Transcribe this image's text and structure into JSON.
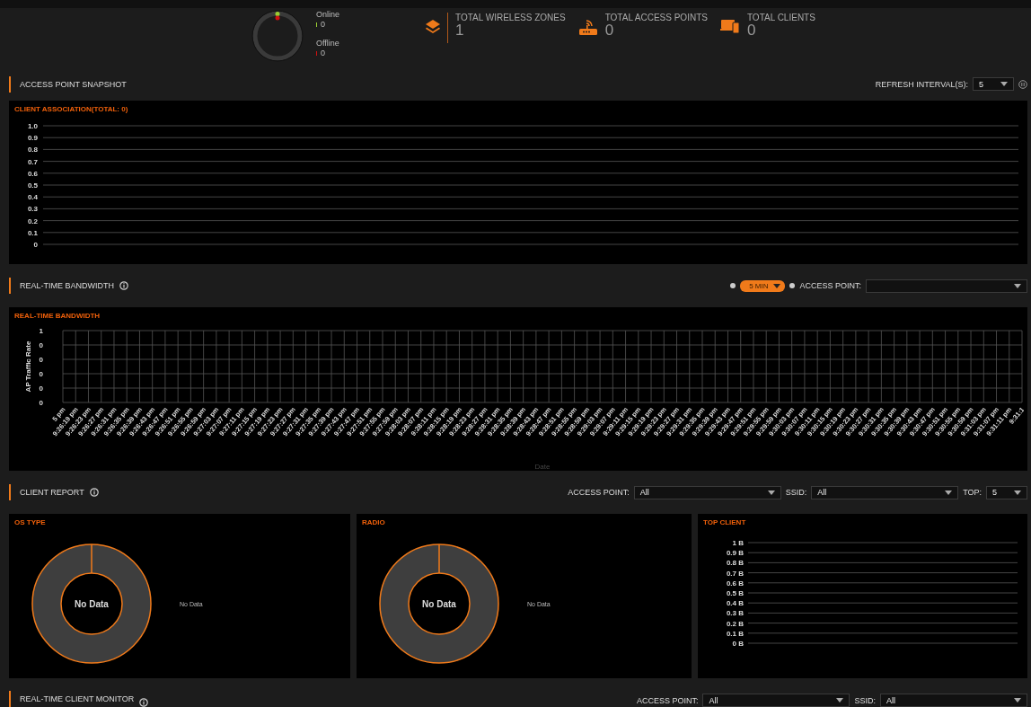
{
  "summary": {
    "online_label": "Online",
    "online_count": "0",
    "offline_label": "Offline",
    "offline_count": "0",
    "stats": [
      {
        "kind": "zones",
        "label": "TOTAL WIRELESS ZONES",
        "value": "1"
      },
      {
        "kind": "access_points",
        "label": "TOTAL ACCESS POINTS",
        "value": "0"
      },
      {
        "kind": "clients",
        "label": "TOTAL CLIENTS",
        "value": "0"
      }
    ]
  },
  "snapshot": {
    "title": "ACCESS POINT SNAPSHOT",
    "refresh_label": "REFRESH INTERVAL(S):",
    "refresh_value": "5",
    "panel": {
      "title": "CLIENT ASSOCIATION(TOTAL: 0)",
      "y_axis_labels": [
        "1.0",
        "0.9",
        "0.8",
        "0.7",
        "0.6",
        "0.5",
        "0.4",
        "0.3",
        "0.2",
        "0.1",
        "0"
      ]
    }
  },
  "bandwidth": {
    "title": "REAL-TIME BANDWIDTH",
    "range_value": "5 MIN",
    "access_point_label": "ACCESS POINT:",
    "panel": {
      "title": "REAL-TIME BANDWIDTH",
      "x_axis_title": "Date",
      "y_axis_title": "AP Traffic Rate",
      "y_axis_labels": [
        "1",
        "0",
        "0",
        "0",
        "0",
        "0"
      ],
      "x_axis_labels": [
        "5 pm",
        "9:26:19 pm",
        "9:26:23 pm",
        "9:26:27 pm",
        "9:26:31 pm",
        "9:26:35 pm",
        "9:26:39 pm",
        "9:26:43 pm",
        "9:26:47 pm",
        "9:26:51 pm",
        "9:26:55 pm",
        "9:26:59 pm",
        "9:27:03 pm",
        "9:27:07 pm",
        "9:27:11 pm",
        "9:27:15 pm",
        "9:27:19 pm",
        "9:27:23 pm",
        "9:27:27 pm",
        "9:27:31 pm",
        "9:27:35 pm",
        "9:27:39 pm",
        "9:27:43 pm",
        "9:27:47 pm",
        "9:27:51 pm",
        "9:27:55 pm",
        "9:27:59 pm",
        "9:28:03 pm",
        "9:28:07 pm",
        "9:28:11 pm",
        "9:28:15 pm",
        "9:28:19 pm",
        "9:28:23 pm",
        "9:28:27 pm",
        "9:28:31 pm",
        "9:28:35 pm",
        "9:28:39 pm",
        "9:28:43 pm",
        "9:28:47 pm",
        "9:28:51 pm",
        "9:28:55 pm",
        "9:28:59 pm",
        "9:29:03 pm",
        "9:29:07 pm",
        "9:29:11 pm",
        "9:29:15 pm",
        "9:29:19 pm",
        "9:29:23 pm",
        "9:29:27 pm",
        "9:29:31 pm",
        "9:29:35 pm",
        "9:29:39 pm",
        "9:29:43 pm",
        "9:29:47 pm",
        "9:29:51 pm",
        "9:29:55 pm",
        "9:29:59 pm",
        "9:30:03 pm",
        "9:30:07 pm",
        "9:30:11 pm",
        "9:30:15 pm",
        "9:30:19 pm",
        "9:30:23 pm",
        "9:30:27 pm",
        "9:30:31 pm",
        "9:30:35 pm",
        "9:30:39 pm",
        "9:30:43 pm",
        "9:30:47 pm",
        "9:30:51 pm",
        "9:30:55 pm",
        "9:30:59 pm",
        "9:31:03 pm",
        "9:31:07 pm",
        "9:31:11 pm",
        "9:31:1"
      ]
    }
  },
  "client_report": {
    "title": "CLIENT REPORT",
    "filters": [
      {
        "label": "ACCESS POINT:",
        "value": "All"
      },
      {
        "label": "SSID:",
        "value": "All"
      },
      {
        "label": "TOP:",
        "value": "5"
      }
    ],
    "panels": [
      {
        "kind": "donut",
        "title": "OS TYPE",
        "center_text": "No Data",
        "legend": "No Data"
      },
      {
        "kind": "donut",
        "title": "RADIO",
        "center_text": "No Data",
        "legend": "No Data"
      },
      {
        "kind": "grid",
        "title": "TOP CLIENT",
        "y_axis_labels": [
          "1 B",
          "0.9 B",
          "0.8 B",
          "0.7 B",
          "0.6 B",
          "0.5 B",
          "0.4 B",
          "0.3 B",
          "0.2 B",
          "0.1 B",
          "0 B"
        ]
      }
    ]
  },
  "client_monitor": {
    "title": "REAL-TIME CLIENT MONITOR",
    "filters": [
      {
        "label": "ACCESS POINT:",
        "value": "All"
      },
      {
        "label": "SSID:",
        "value": "All"
      }
    ]
  }
}
